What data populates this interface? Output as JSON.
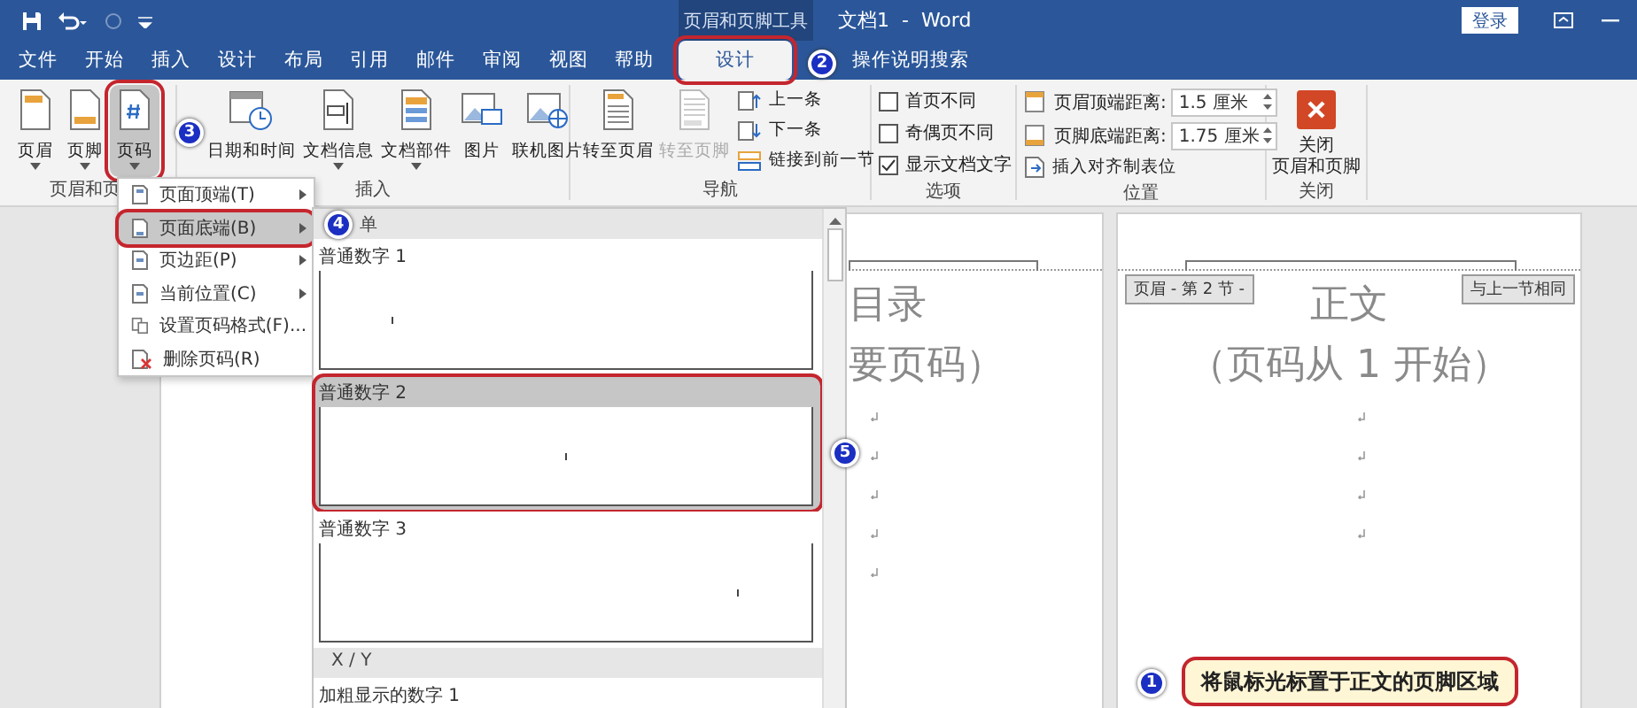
{
  "title_bar": {
    "context_label": "页眉和页脚工具",
    "title": "文档1  -  Word",
    "sign_in": "登录"
  },
  "tabs": [
    {
      "label": "文件",
      "selected": false,
      "context": false
    },
    {
      "label": "开始",
      "selected": false,
      "context": false
    },
    {
      "label": "插入",
      "selected": false,
      "context": false
    },
    {
      "label": "设计",
      "selected": false,
      "context": false
    },
    {
      "label": "布局",
      "selected": false,
      "context": false
    },
    {
      "label": "引用",
      "selected": false,
      "context": false
    },
    {
      "label": "邮件",
      "selected": false,
      "context": false
    },
    {
      "label": "审阅",
      "selected": false,
      "context": false
    },
    {
      "label": "视图",
      "selected": false,
      "context": false
    },
    {
      "label": "帮助",
      "selected": false,
      "context": false
    },
    {
      "label": "设计",
      "selected": true,
      "context": true
    }
  ],
  "search": "操作说明搜索",
  "ribbon": [
    {
      "label": "页眉和页",
      "items": [
        {
          "kind": "large",
          "label": "页眉",
          "dropdown": true,
          "pressed": false,
          "disabled": false
        },
        {
          "kind": "large",
          "label": "页脚",
          "dropdown": true,
          "pressed": false,
          "disabled": false
        },
        {
          "kind": "large",
          "label": "页码",
          "dropdown": true,
          "pressed": true,
          "disabled": false
        }
      ]
    },
    {
      "label": "插入",
      "items": [
        {
          "kind": "large",
          "label": "日期和时间",
          "dropdown": false,
          "pressed": false,
          "disabled": false
        },
        {
          "kind": "large",
          "label": "文档信息",
          "dropdown": true,
          "pressed": false,
          "disabled": false
        },
        {
          "kind": "large",
          "label": "文档部件",
          "dropdown": true,
          "pressed": false,
          "disabled": false
        },
        {
          "kind": "large",
          "label": "图片",
          "dropdown": false,
          "pressed": false,
          "disabled": false
        },
        {
          "kind": "large",
          "label": "联机图片",
          "dropdown": false,
          "pressed": false,
          "disabled": false
        }
      ]
    },
    {
      "label": "导航",
      "items": [
        {
          "kind": "large",
          "label": "转至页眉",
          "dropdown": false,
          "pressed": false,
          "disabled": false
        },
        {
          "kind": "large",
          "label": "转至页脚",
          "dropdown": false,
          "pressed": false,
          "disabled": true
        },
        {
          "kind": "small",
          "label": "上一条",
          "disabled": false
        },
        {
          "kind": "small",
          "label": "下一条",
          "disabled": false
        },
        {
          "kind": "small",
          "label": "链接到前一节",
          "disabled": false
        }
      ]
    },
    {
      "label": "选项",
      "items": [
        {
          "kind": "checkbox",
          "label": "首页不同",
          "checked": false
        },
        {
          "kind": "checkbox",
          "label": "奇偶页不同",
          "checked": false
        },
        {
          "kind": "checkbox",
          "label": "显示文档文字",
          "checked": true
        }
      ]
    },
    {
      "label": "位置",
      "items": [
        {
          "kind": "spinner",
          "label": "页眉顶端距离:",
          "value": "1.5 厘米"
        },
        {
          "kind": "spinner",
          "label": "页脚底端距离:",
          "value": "1.75 厘米"
        },
        {
          "kind": "small",
          "label": "插入对齐制表位",
          "disabled": false
        }
      ]
    },
    {
      "label": "关闭",
      "items": [
        {
          "kind": "close",
          "lines": [
            "关闭",
            "页眉和页脚"
          ]
        }
      ]
    }
  ],
  "pages": [
    {
      "lines": [
        "目录",
        "要页码）"
      ]
    },
    {
      "header_tag": "页眉 - 第 2 节 -",
      "link_tag": "与上一节相同",
      "lines": [
        "正文",
        "（页码从 1 开始）"
      ]
    }
  ],
  "page_number_menu": [
    {
      "label": "页面顶端(T)",
      "submenu": true,
      "selected": false
    },
    {
      "label": "页面底端(B)",
      "submenu": true,
      "selected": true
    },
    {
      "label": "页边距(P)",
      "submenu": true,
      "selected": false
    },
    {
      "label": "当前位置(C)",
      "submenu": true,
      "selected": false
    },
    {
      "label": "设置页码格式(F)...",
      "submenu": false,
      "selected": false
    },
    {
      "label": "删除页码(R)",
      "submenu": false,
      "selected": false
    }
  ],
  "gallery": [
    {
      "title": "单",
      "items": [
        {
          "kind": "left",
          "label": "普通数字 1",
          "selected": false
        },
        {
          "kind": "center",
          "label": "普通数字 2",
          "selected": true
        },
        {
          "kind": "right",
          "label": "普通数字 3",
          "selected": false
        }
      ]
    },
    {
      "title": "X / Y",
      "items": [
        {
          "kind": "label",
          "label": "加粗显示的数字 1",
          "selected": false
        }
      ]
    }
  ],
  "steps": [
    {
      "number": "1",
      "text": "将鼠标光标置于正文的页脚区域"
    },
    {
      "number": "2"
    },
    {
      "number": "3"
    },
    {
      "number": "4"
    },
    {
      "number": "5"
    }
  ]
}
